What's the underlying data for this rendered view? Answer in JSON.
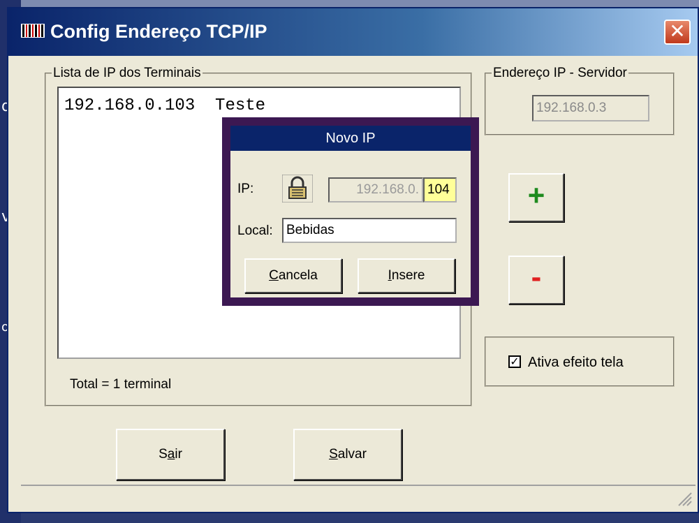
{
  "window": {
    "title": "Config Endereço TCP/IP"
  },
  "terminals": {
    "legend": "Lista de IP dos Terminais",
    "items": [
      {
        "ip": "192.168.0.103",
        "local": "Teste"
      }
    ],
    "total": "Total = 1 terminal"
  },
  "server": {
    "legend": "Endereço IP - Servidor",
    "ip": "192.168.0.3"
  },
  "buttons": {
    "add": "+",
    "remove": "-",
    "exit_pre": "S",
    "exit_mnemonic": "a",
    "exit_post": "ir",
    "save_mnemonic": "S",
    "save_post": "alvar"
  },
  "option": {
    "checked": true,
    "label": "Ativa efeito tela",
    "check_glyph": "✓"
  },
  "dialog": {
    "title": "Novo IP",
    "ip_label": "IP:",
    "ip_prefix": "192.168.0.",
    "ip_last": "104",
    "local_label": "Local:",
    "local_value": "Bebidas",
    "cancel_mnemonic": "C",
    "cancel_post": "ancela",
    "insert_mnemonic": "I",
    "insert_post": "nsere"
  },
  "desktop": {
    "chars": [
      "d",
      "v",
      "ol"
    ]
  },
  "colors": {
    "titlebar": "#0a246a",
    "add_icon": "#1e8a1e",
    "remove_icon": "#e02020",
    "dialog_frame": "#3c1852",
    "ip_highlight": "#ffff99"
  },
  "icons": {
    "title": "barcode-icon",
    "close": "close-icon",
    "lock": "padlock-icon",
    "grip": "resize-grip-icon"
  }
}
